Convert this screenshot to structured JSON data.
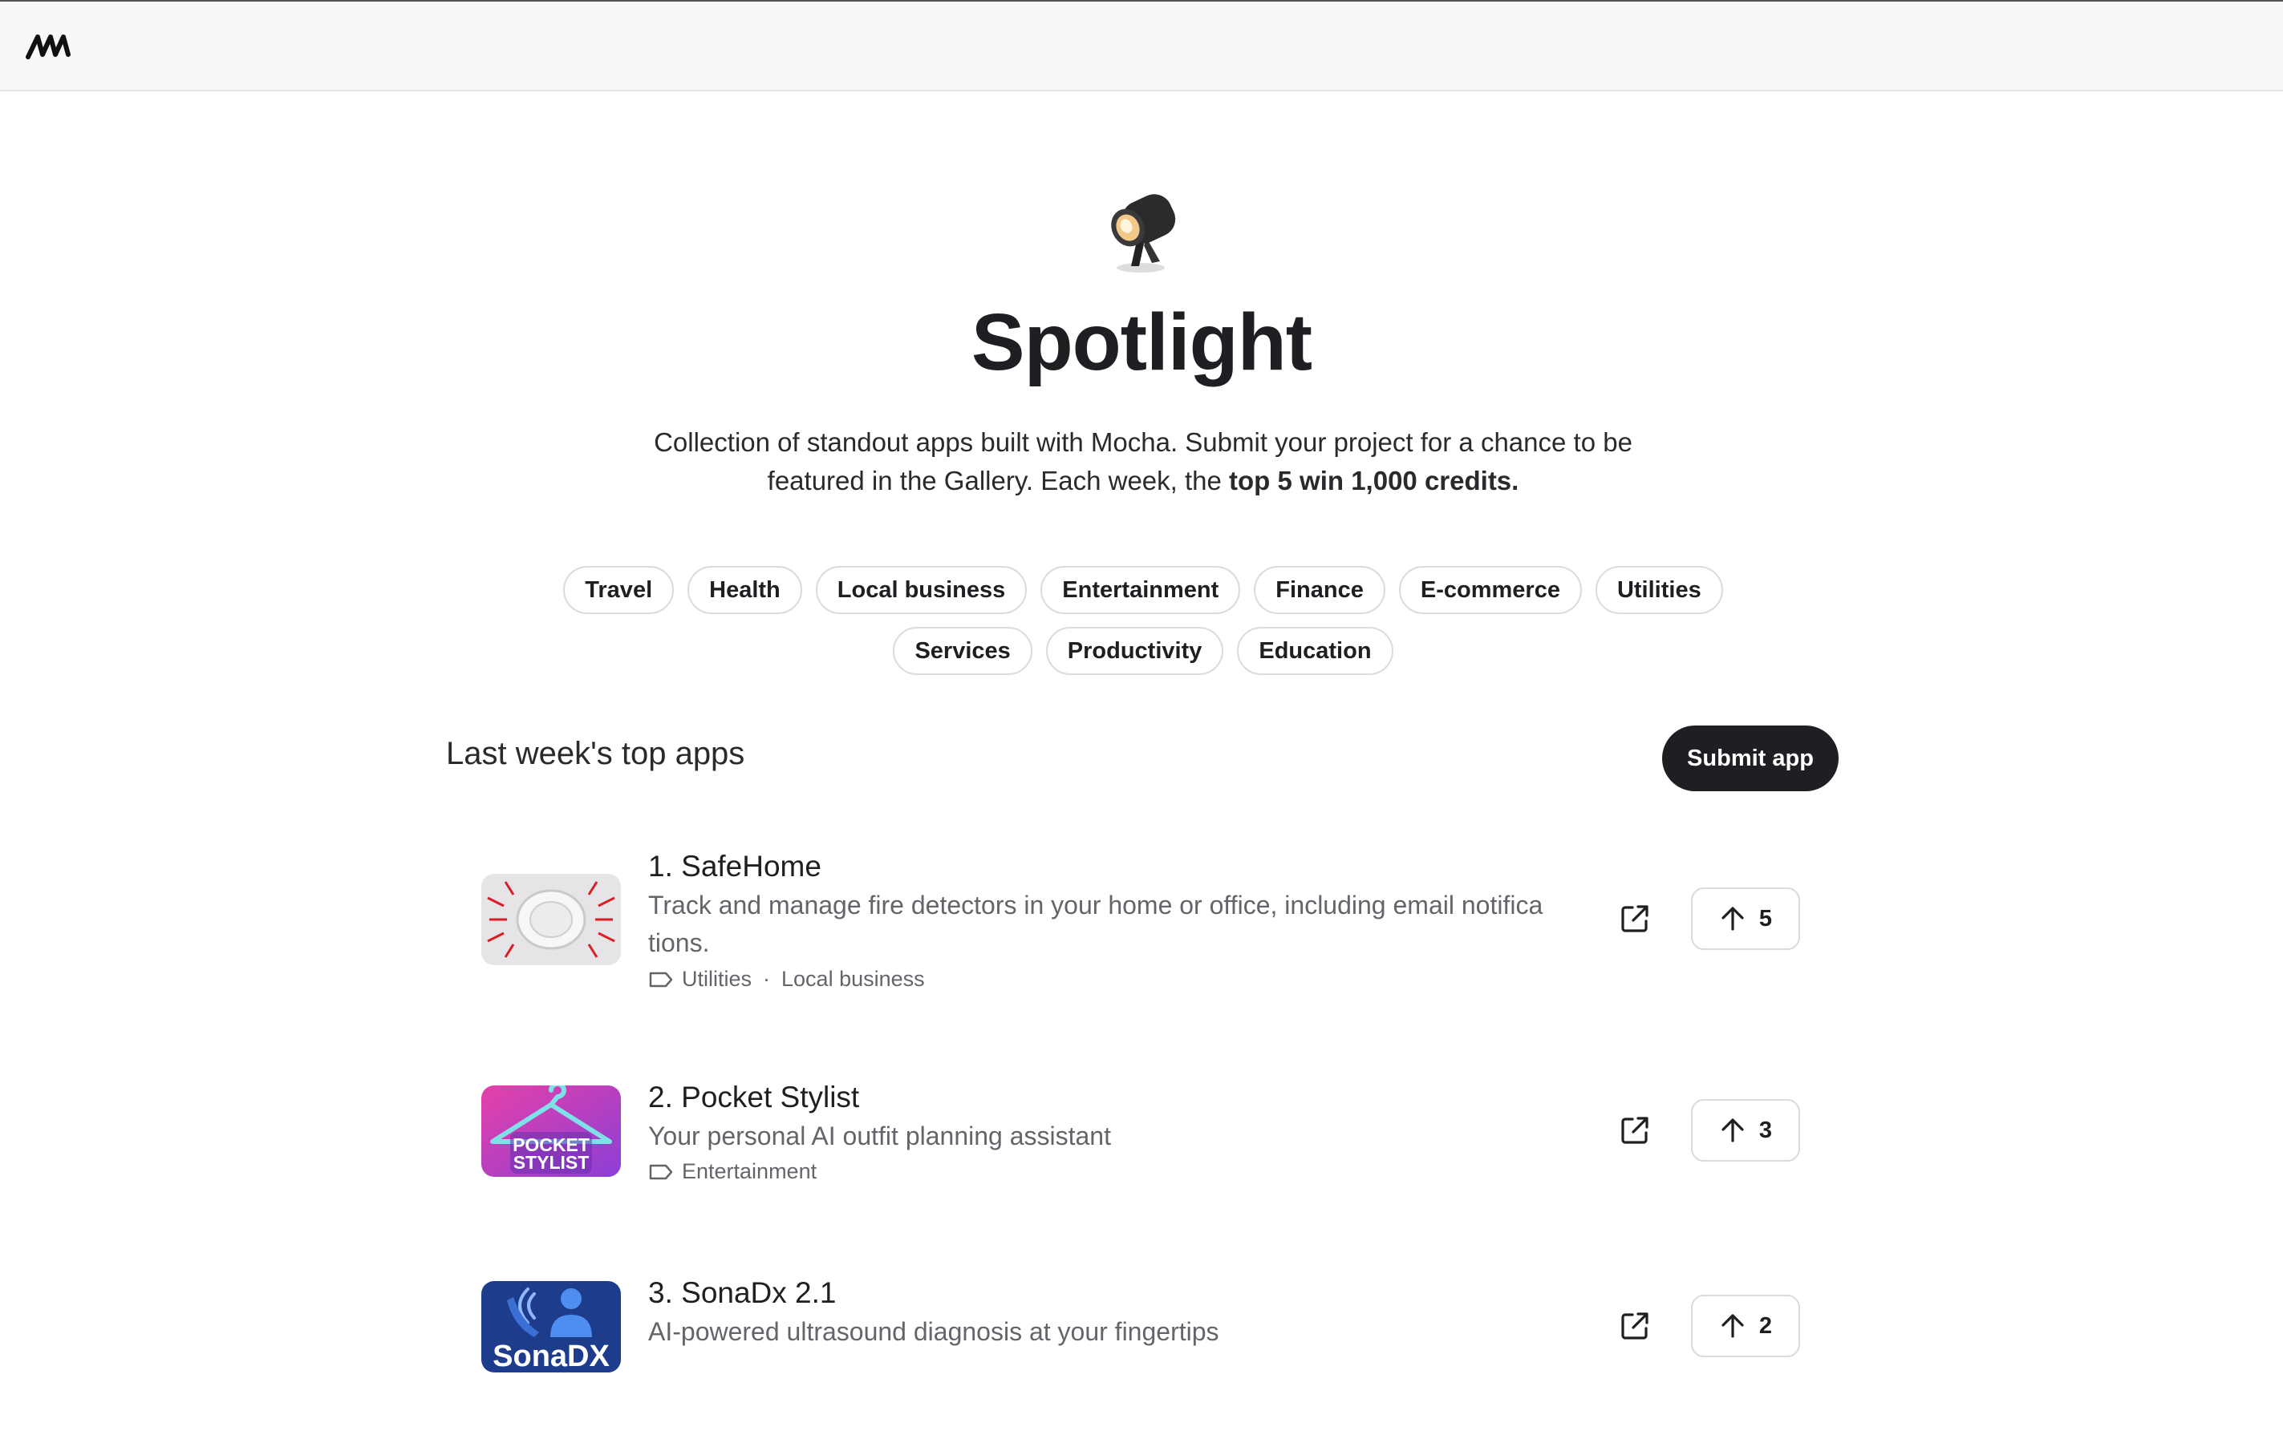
{
  "header": {
    "logo_icon": "mocha-logo-icon"
  },
  "hero": {
    "icon": "spotlight-icon",
    "title": "Spotlight",
    "subtitle_main": "Collection of standout apps built with Mocha. Submit your project for a chance to be featured in the Gallery. Each week, the ",
    "subtitle_bold": "top 5 win 1,000 credits."
  },
  "categories": [
    "Travel",
    "Health",
    "Local business",
    "Entertainment",
    "Finance",
    "E-commerce",
    "Utilities",
    "Services",
    "Productivity",
    "Education"
  ],
  "section": {
    "title": "Last week's top apps",
    "submit_label": "Submit app"
  },
  "apps": [
    {
      "name": "1. SafeHome",
      "description": "Track and manage fire detectors in your home or office, including email notifica tions.",
      "tags": [
        "Utilities",
        "Local business"
      ],
      "votes": "5",
      "thumbnail": "smoke-detector-image"
    },
    {
      "name": "2. Pocket Stylist",
      "description": "Your personal AI outfit planning assistant",
      "tags": [
        "Entertainment"
      ],
      "votes": "3",
      "thumbnail": "pocket-stylist-logo",
      "thumb_text_1": "POCKET",
      "thumb_text_2": "STYLIST"
    },
    {
      "name": "3. SonaDx 2.1",
      "description": "AI-powered ultrasound diagnosis at your fingertips",
      "tags": [],
      "votes": "2",
      "thumbnail": "sonadx-logo",
      "thumb_text": "SonaDX"
    }
  ],
  "icons": {
    "tag": "tag-icon",
    "external": "external-link-icon",
    "upvote": "arrow-up-icon"
  }
}
